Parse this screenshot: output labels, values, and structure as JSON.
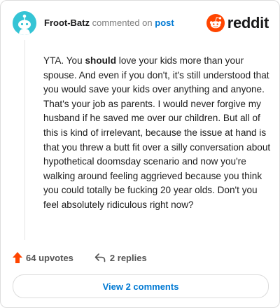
{
  "comment": {
    "username": "Froot-Batz",
    "action_text": "commented on",
    "target_link": "post",
    "body_segments": [
      "YTA. You ",
      "should",
      " love your kids more than your spouse. And even if you don't, it's still understood that you would save your kids over anything and anyone. That's your job as parents. I would never forgive my husband if he saved me over our children. But all of this is kind of irrelevant, because the issue at hand is that you threw a butt fit over a silly conversation about hypothetical doomsday scenario and now you're walking around feeling aggrieved because you think you could totally be fucking 20 year olds. Don't you feel absolutely ridiculous right now?"
    ]
  },
  "brand": {
    "name": "reddit",
    "icon": "reddit-logo-icon",
    "color": "#ff4500"
  },
  "actions": {
    "upvotes_label": "64 upvotes",
    "replies_label": "2 replies"
  },
  "footer": {
    "view_comments_label": "View 2 comments"
  },
  "colors": {
    "upvote": "#ff4500",
    "link": "#0079d3",
    "avatar_bg": "#35c4d5"
  }
}
